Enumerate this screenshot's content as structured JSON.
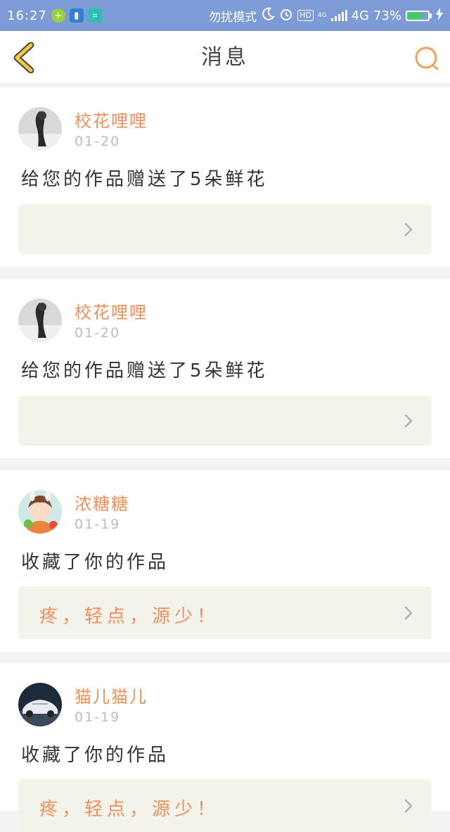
{
  "status_bar": {
    "time": "16:27",
    "mode": "勿扰模式",
    "hd": "HD",
    "net_small": "4G",
    "network": "4G",
    "battery_pct": "73%",
    "battery_level": 0.73,
    "icons": [
      "plus-app-icon",
      "battery-app-icon",
      "scan-app-icon",
      "moon-icon",
      "alarm-icon",
      "signal-icon",
      "charging-icon"
    ]
  },
  "nav": {
    "title": "消息",
    "back_icon": "chevron-left-icon",
    "search_icon": "search-icon",
    "accent": "#f5a15c",
    "back_color": "#f0c83a"
  },
  "colors": {
    "status_bar_bg": "#7d9bd6",
    "username": "#f08f5a",
    "date": "#bdbdbd",
    "quote_bg": "#f3f3ec",
    "page_bg": "#f3f3f3"
  },
  "messages": [
    {
      "username": "校花哩哩",
      "date": "01-20",
      "text": "给您的作品赠送了5朵鲜花",
      "quote": ""
    },
    {
      "username": "校花哩哩",
      "date": "01-20",
      "text": "给您的作品赠送了5朵鲜花",
      "quote": ""
    },
    {
      "username": "浓糖糖",
      "date": "01-19",
      "text": "收藏了你的作品",
      "quote": "疼，轻点，源少！"
    },
    {
      "username": "猫儿猫儿",
      "date": "01-19",
      "text": "收藏了你的作品",
      "quote": "疼，轻点，源少！"
    }
  ]
}
